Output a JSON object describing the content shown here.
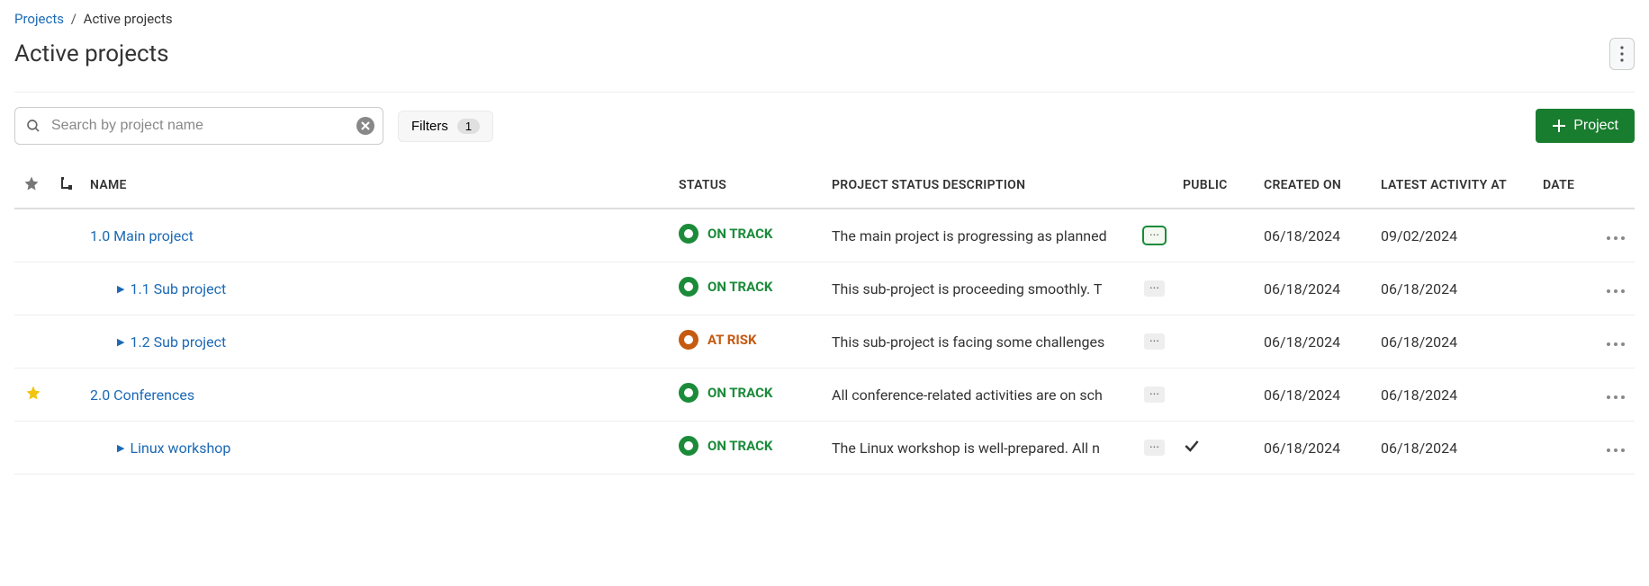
{
  "breadcrumb": {
    "root": "Projects",
    "current": "Active projects"
  },
  "page_title": "Active projects",
  "search": {
    "placeholder": "Search by project name",
    "value": ""
  },
  "filters": {
    "label": "Filters",
    "count": "1"
  },
  "create_button": "Project",
  "columns": {
    "name": "Name",
    "status": "Status",
    "description": "Project status description",
    "public": "Public",
    "created_on": "Created on",
    "latest_activity": "Latest activity at",
    "date": "Date"
  },
  "status_labels": {
    "on_track": "ON TRACK",
    "at_risk": "AT RISK"
  },
  "rows": [
    {
      "starred": false,
      "indent": 0,
      "expandable": false,
      "name": "1.0 Main project",
      "status": "on_track",
      "description": "The main project is progressing as planned",
      "desc_highlight": true,
      "public": false,
      "created_on": "06/18/2024",
      "latest_activity": "09/02/2024",
      "date": ""
    },
    {
      "starred": false,
      "indent": 1,
      "expandable": true,
      "name": "1.1 Sub project",
      "status": "on_track",
      "description": "This sub-project is proceeding smoothly. T",
      "desc_highlight": false,
      "public": false,
      "created_on": "06/18/2024",
      "latest_activity": "06/18/2024",
      "date": ""
    },
    {
      "starred": false,
      "indent": 1,
      "expandable": true,
      "name": "1.2 Sub project",
      "status": "at_risk",
      "description": "This sub-project is facing some challenges",
      "desc_highlight": false,
      "public": false,
      "created_on": "06/18/2024",
      "latest_activity": "06/18/2024",
      "date": ""
    },
    {
      "starred": true,
      "indent": 0,
      "expandable": false,
      "name": "2.0 Conferences",
      "status": "on_track",
      "description": "All conference-related activities are on sch",
      "desc_highlight": false,
      "public": false,
      "created_on": "06/18/2024",
      "latest_activity": "06/18/2024",
      "date": ""
    },
    {
      "starred": false,
      "indent": 1,
      "expandable": true,
      "name": "Linux workshop",
      "status": "on_track",
      "description": "The Linux workshop is well-prepared. All n",
      "desc_highlight": false,
      "public": true,
      "created_on": "06/18/2024",
      "latest_activity": "06/18/2024",
      "date": ""
    }
  ]
}
